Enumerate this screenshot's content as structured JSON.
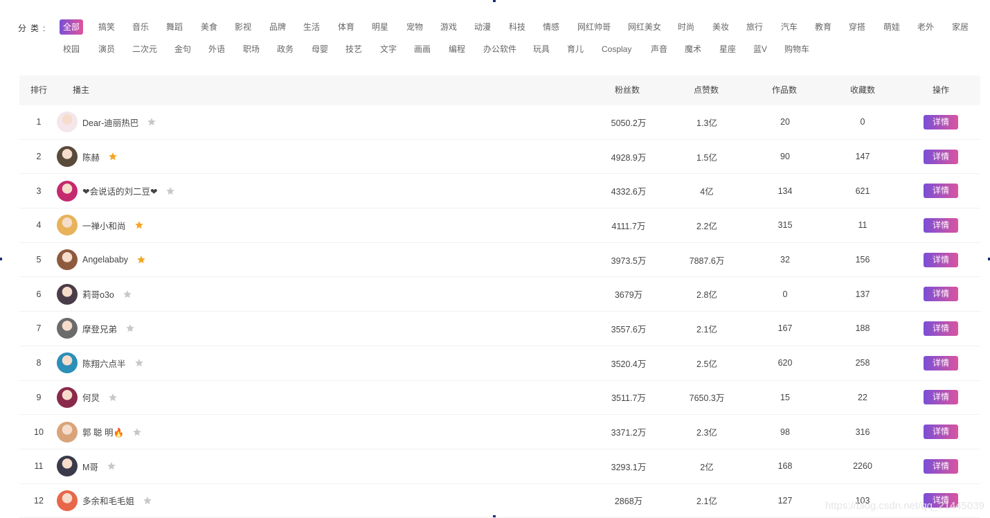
{
  "filter": {
    "title": "分类:",
    "row1": [
      "全部",
      "搞笑",
      "音乐",
      "舞蹈",
      "美食",
      "影视",
      "品牌",
      "生活",
      "体育",
      "明星",
      "宠物",
      "游戏",
      "动漫",
      "科技",
      "情感",
      "网红帅哥",
      "网红美女",
      "时尚",
      "美妆",
      "旅行",
      "汽车",
      "教育",
      "穿搭",
      "萌娃",
      "老外",
      "家居"
    ],
    "row2": [
      "校园",
      "演员",
      "二次元",
      "金句",
      "外语",
      "职场",
      "政务",
      "母婴",
      "技艺",
      "文字",
      "画画",
      "编程",
      "办公软件",
      "玩具",
      "育儿",
      "Cosplay",
      "声音",
      "魔术",
      "星座",
      "蓝V",
      "购物车"
    ],
    "active": "全部",
    "accent_start": "#7a4fd6",
    "accent_end": "#e0539b"
  },
  "table": {
    "headers": {
      "rank": "排行",
      "user": "播主",
      "fans": "粉丝数",
      "likes": "点赞数",
      "works": "作品数",
      "favorites": "收藏数",
      "action": "操作"
    },
    "rows": [
      {
        "rank": "1",
        "name": "Dear-迪丽热巴",
        "starred": false,
        "fans": "5050.2万",
        "likes": "1.3亿",
        "works": "20",
        "favorites": "0",
        "action": "详情",
        "avatar_color": "#f4e6ea"
      },
      {
        "rank": "2",
        "name": "陈赫",
        "starred": true,
        "fans": "4928.9万",
        "likes": "1.5亿",
        "works": "90",
        "favorites": "147",
        "action": "详情",
        "avatar_color": "#5a4a3c"
      },
      {
        "rank": "3",
        "name": "❤会说话的刘二豆❤",
        "starred": false,
        "fans": "4332.6万",
        "likes": "4亿",
        "works": "134",
        "favorites": "621",
        "action": "详情",
        "avatar_color": "#c42a6e"
      },
      {
        "rank": "4",
        "name": "一禅小和尚",
        "starred": true,
        "fans": "4111.7万",
        "likes": "2.2亿",
        "works": "315",
        "favorites": "11",
        "action": "详情",
        "avatar_color": "#e7b25a"
      },
      {
        "rank": "5",
        "name": "Angelababy",
        "starred": true,
        "fans": "3973.5万",
        "likes": "7887.6万",
        "works": "32",
        "favorites": "156",
        "action": "详情",
        "avatar_color": "#8e5a3e"
      },
      {
        "rank": "6",
        "name": "莉哥o3o",
        "starred": false,
        "fans": "3679万",
        "likes": "2.8亿",
        "works": "0",
        "favorites": "137",
        "action": "详情",
        "avatar_color": "#4a3c48"
      },
      {
        "rank": "7",
        "name": "摩登兄弟",
        "starred": false,
        "fans": "3557.6万",
        "likes": "2.1亿",
        "works": "167",
        "favorites": "188",
        "action": "详情",
        "avatar_color": "#6b6b6b"
      },
      {
        "rank": "8",
        "name": "陈翔六点半",
        "starred": false,
        "fans": "3520.4万",
        "likes": "2.5亿",
        "works": "620",
        "favorites": "258",
        "action": "详情",
        "avatar_color": "#2b8fb8"
      },
      {
        "rank": "9",
        "name": "何炅",
        "starred": false,
        "fans": "3511.7万",
        "likes": "7650.3万",
        "works": "15",
        "favorites": "22",
        "action": "详情",
        "avatar_color": "#8a2a4a"
      },
      {
        "rank": "10",
        "name": "郭 聪 明🔥",
        "starred": false,
        "fans": "3371.2万",
        "likes": "2.3亿",
        "works": "98",
        "favorites": "316",
        "action": "详情",
        "avatar_color": "#d9a47a"
      },
      {
        "rank": "11",
        "name": "M哥",
        "starred": false,
        "fans": "3293.1万",
        "likes": "2亿",
        "works": "168",
        "favorites": "2260",
        "action": "详情",
        "avatar_color": "#3a3a4a"
      },
      {
        "rank": "12",
        "name": "多余和毛毛姐",
        "starred": false,
        "fans": "2868万",
        "likes": "2.1亿",
        "works": "127",
        "favorites": "103",
        "action": "详情",
        "avatar_color": "#e8674a"
      }
    ],
    "star_on_color": "#f5a623",
    "star_off_color": "#c8c8c8"
  },
  "watermark": "https://blog.csdn.net/qq_21445039"
}
